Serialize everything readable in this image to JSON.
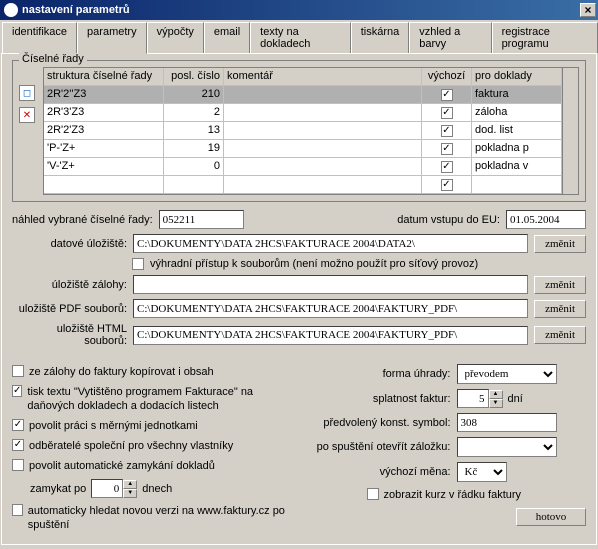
{
  "window": {
    "title": "nastavení parametrů",
    "close": "×"
  },
  "tabs": [
    "identifikace",
    "parametry",
    "výpočty",
    "email",
    "texty na dokladech",
    "tiskárna",
    "vzhled a barvy",
    "registrace programu"
  ],
  "activeTab": 1,
  "numberSeries": {
    "legend": "Číselné řady",
    "cols": {
      "c1": "struktura číselné řady",
      "c2": "posl. číslo",
      "c3": "komentář",
      "c4": "výchozí",
      "c5": "pro doklady"
    },
    "rows": [
      {
        "c1": "2R'2''Z3",
        "c2": "210",
        "c3": "",
        "c4": true,
        "c5": "faktura",
        "sel": true
      },
      {
        "c1": "2R'3'Z3",
        "c2": "2",
        "c3": "",
        "c4": true,
        "c5": "záloha"
      },
      {
        "c1": "2R'2'Z3",
        "c2": "13",
        "c3": "",
        "c4": true,
        "c5": "dod. list"
      },
      {
        "c1": "'P-'Z+",
        "c2": "19",
        "c3": "",
        "c4": true,
        "c5": "pokladna p"
      },
      {
        "c1": "'V-'Z+",
        "c2": "0",
        "c3": "",
        "c4": true,
        "c5": "pokladna v"
      },
      {
        "c1": "",
        "c2": "",
        "c3": "",
        "c4": true,
        "c5": ""
      }
    ]
  },
  "preview": {
    "label": "náhled vybrané číselné řady:",
    "value": "052211",
    "euLabel": "datum vstupu do EU:",
    "euValue": "01.05.2004"
  },
  "storage": {
    "label": "datové úložiště:",
    "value": "C:\\DOKUMENTY\\DATA 2HCS\\FAKTURACE 2004\\DATA2\\",
    "btn": "změnit",
    "exclusive": "výhradní přístup k souborům (není možno použít pro síťový provoz)",
    "backupLabel": "úložiště zálohy:",
    "backupValue": "",
    "backupBtn": "změnit",
    "pdfLabel": "uložiště PDF souborů:",
    "pdfValue": "C:\\DOKUMENTY\\DATA 2HCS\\FAKTURACE 2004\\FAKTURY_PDF\\",
    "pdfBtn": "změnit",
    "htmlLabel": "uložiště HTML souborů:",
    "htmlValue": "C:\\DOKUMENTY\\DATA 2HCS\\FAKTURACE 2004\\FAKTURY_PDF\\",
    "htmlBtn": "změnit"
  },
  "left": {
    "copyBackup": "ze zálohy do faktury kopírovat i obsah",
    "printText": "tisk textu \"Vytištěno programem Fakturace\" na daňových dokladech a dodacích listech",
    "units": "povolit práci s měrnými jednotkami",
    "shared": "odběratelé společní pro všechny vlastníky",
    "autolock": "povolit automatické zamykání dokladů",
    "lockAfter": "zamykat po",
    "lockDays": "0",
    "lockUnit": "dnech",
    "autoUpdate": "automaticky hledat novou verzi na www.faktury.cz po spuštění"
  },
  "right": {
    "paymentLabel": "forma úhrady:",
    "paymentValue": "převodem",
    "dueLabel": "splatnost faktur:",
    "dueValue": "5",
    "dueUnit": "dní",
    "symbolLabel": "předvolený konst. symbol:",
    "symbolValue": "308",
    "tabLabel": "po spuštění otevřít záložku:",
    "tabValue": "",
    "currencyLabel": "výchozí měna:",
    "currencyValue": "Kč",
    "showRate": "zobrazit kurz v řádku faktury"
  },
  "done": "hotovo"
}
